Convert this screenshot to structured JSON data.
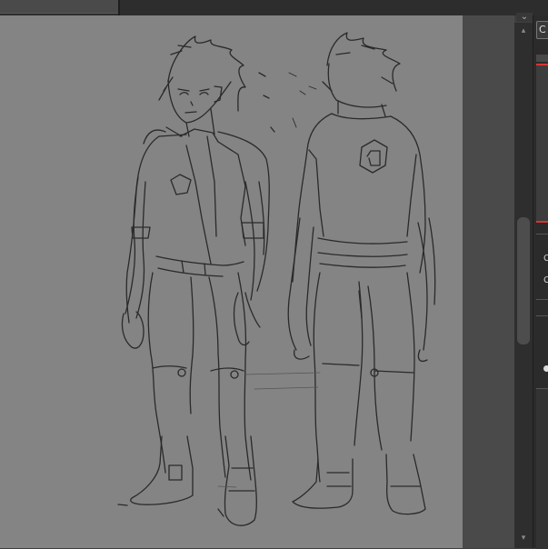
{
  "window": {
    "minimize_glyph": "⌄"
  },
  "canvas": {
    "description_icon": "canvas-sketch",
    "paper_color": "#848484",
    "stroke_color": "#2a2a2a"
  },
  "panel": {
    "button_label": "C",
    "row_labels": [
      "C",
      "C"
    ],
    "accent_color": "#d33333"
  },
  "scrollbar": {
    "up_glyph": "▴",
    "down_glyph": "▾"
  }
}
